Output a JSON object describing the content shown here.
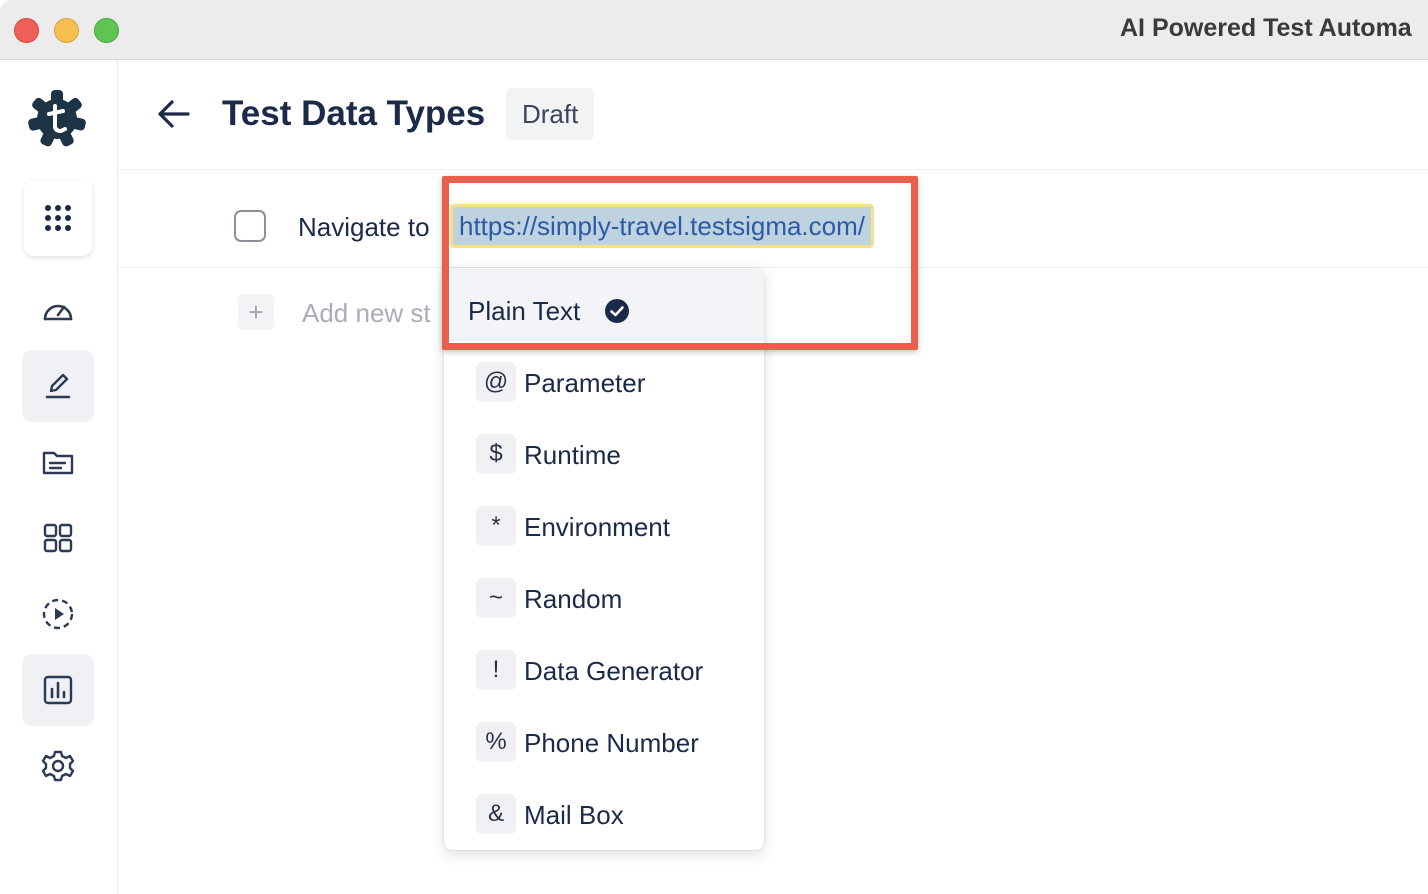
{
  "window": {
    "title": "AI Powered Test Automa"
  },
  "sidebar": {
    "logo_icon": "testsigma-logo-icon",
    "items": [
      {
        "name": "apps-grid",
        "icon": "apps-grid-icon"
      },
      {
        "name": "dashboard",
        "icon": "gauge-icon"
      },
      {
        "name": "test-authoring",
        "icon": "pencil-icon",
        "active": true
      },
      {
        "name": "files",
        "icon": "folder-icon"
      },
      {
        "name": "modules",
        "icon": "grid-icon"
      },
      {
        "name": "run",
        "icon": "play-circle-icon"
      },
      {
        "name": "reports",
        "icon": "bar-chart-icon",
        "active": true
      },
      {
        "name": "settings",
        "icon": "gear-icon"
      }
    ]
  },
  "header": {
    "title": "Test Data Types",
    "status": "Draft"
  },
  "step": {
    "text": "Navigate to",
    "url": "https://simply-travel.testsigma.com/"
  },
  "add_step": {
    "label": "Add new st"
  },
  "dropdown": {
    "selected": "Plain Text",
    "items": [
      {
        "symbol": "@",
        "label": "Parameter"
      },
      {
        "symbol": "$",
        "label": "Runtime"
      },
      {
        "symbol": "*",
        "label": "Environment"
      },
      {
        "symbol": "~",
        "label": "Random"
      },
      {
        "symbol": "!",
        "label": "Data Generator"
      },
      {
        "symbol": "%",
        "label": "Phone Number"
      },
      {
        "symbol": "&",
        "label": "Mail Box"
      }
    ]
  },
  "colors": {
    "accent": "#1b2a48",
    "highlight": "#e8604c",
    "url_selection": "#bfd2df"
  }
}
